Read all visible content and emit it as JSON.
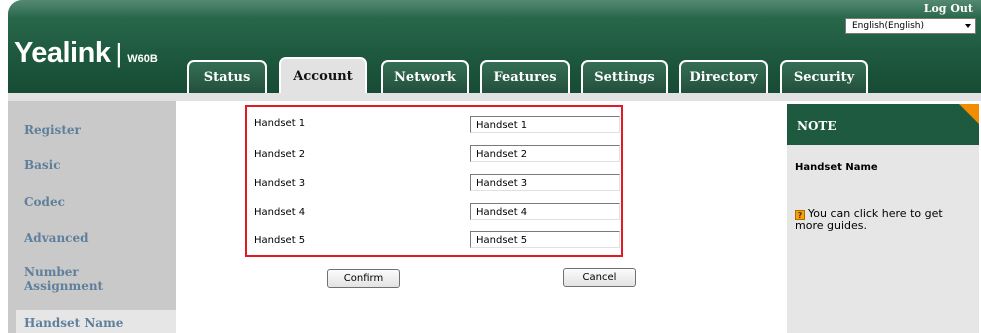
{
  "header": {
    "logo": {
      "brand": "Yealink",
      "separator": "|",
      "model": "W60B"
    },
    "logout_label": "Log Out",
    "language": {
      "selected": "English(English)"
    }
  },
  "tabs": [
    {
      "label": "Status",
      "active": false
    },
    {
      "label": "Account",
      "active": true
    },
    {
      "label": "Network",
      "active": false
    },
    {
      "label": "Features",
      "active": false
    },
    {
      "label": "Settings",
      "active": false
    },
    {
      "label": "Directory",
      "active": false
    },
    {
      "label": "Security",
      "active": false
    }
  ],
  "sidebar": {
    "items": [
      {
        "label": "Register"
      },
      {
        "label": "Basic"
      },
      {
        "label": "Codec"
      },
      {
        "label": "Advanced"
      },
      {
        "label": "Number Assignment"
      },
      {
        "label": "Handset Name",
        "active": true
      }
    ]
  },
  "handsets": [
    {
      "label": "Handset 1",
      "value": "Handset 1"
    },
    {
      "label": "Handset 2",
      "value": "Handset 2"
    },
    {
      "label": "Handset 3",
      "value": "Handset 3"
    },
    {
      "label": "Handset 4",
      "value": "Handset 4"
    },
    {
      "label": "Handset 5",
      "value": "Handset 5"
    }
  ],
  "buttons": {
    "confirm": "Confirm",
    "cancel": "Cancel"
  },
  "note": {
    "title": "NOTE",
    "subtitle": "Handset Name",
    "help_text": "You can click here to get more guides.",
    "help_icon": "help-book-icon"
  },
  "colors": {
    "header_green": "#1e5a3f",
    "highlight_red": "#e11b22",
    "note_corner": "#f28c00",
    "sidebar_text": "#5f7f9c"
  }
}
